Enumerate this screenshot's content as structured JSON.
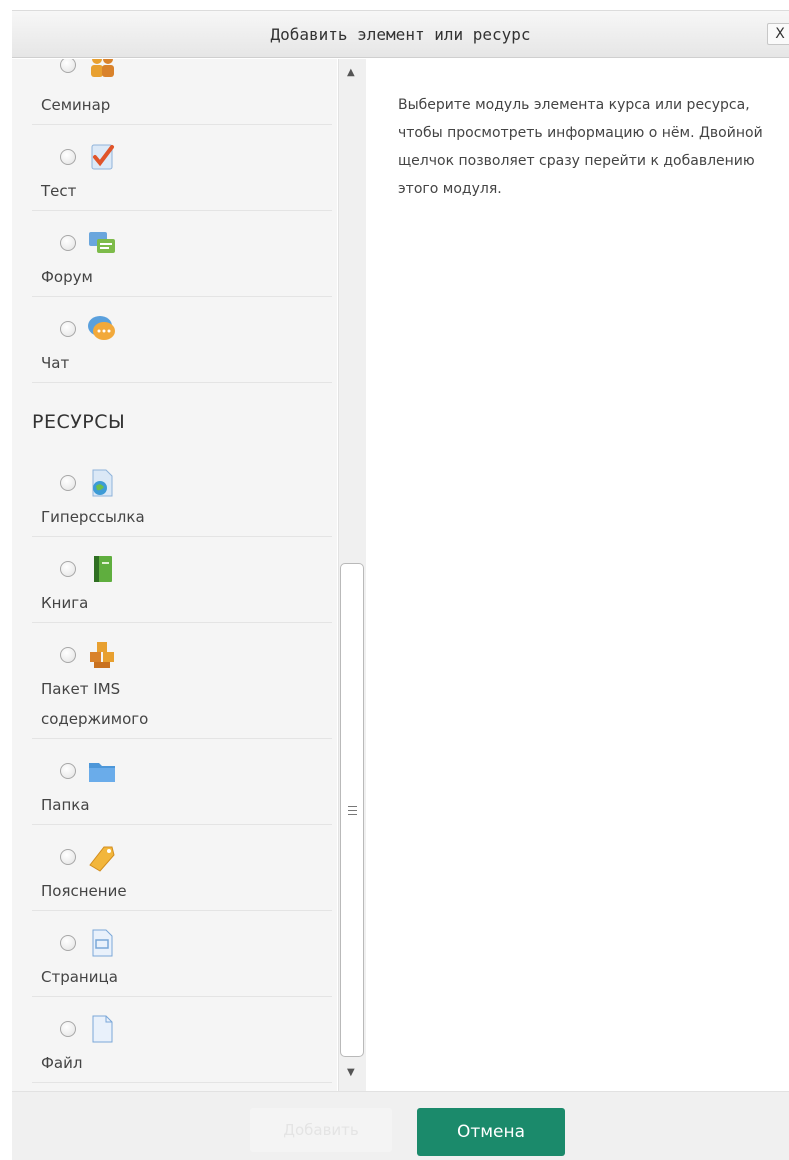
{
  "dialog": {
    "title": "Добавить элемент или ресурс",
    "close_label": "X",
    "accent_color": "#1b8a6b"
  },
  "options": {
    "activities": [
      {
        "label": "Семинар",
        "icon": "workshop-icon"
      },
      {
        "label": "Тест",
        "icon": "quiz-icon"
      },
      {
        "label": "Форум",
        "icon": "forum-icon"
      },
      {
        "label": "Чат",
        "icon": "chat-icon"
      }
    ],
    "resources_heading": "РЕСУРСЫ",
    "resources": [
      {
        "label": "Гиперссылка",
        "icon": "url-icon"
      },
      {
        "label": "Книга",
        "icon": "book-icon"
      },
      {
        "label_line1": "Пакет IMS",
        "label_line2": "содержимого",
        "icon": "ims-package-icon"
      },
      {
        "label": "Папка",
        "icon": "folder-icon"
      },
      {
        "label": "Пояснение",
        "icon": "label-tag-icon"
      },
      {
        "label": "Страница",
        "icon": "page-icon"
      },
      {
        "label": "Файл",
        "icon": "file-icon"
      }
    ]
  },
  "info": {
    "text": "Выберите модуль элемента курса или ресурса, чтобы просмотреть информацию о нём. Двойной щелчок позволяет сразу перейти к добавлению этого модуля."
  },
  "footer": {
    "add_label": "Добавить",
    "cancel_label": "Отмена"
  }
}
